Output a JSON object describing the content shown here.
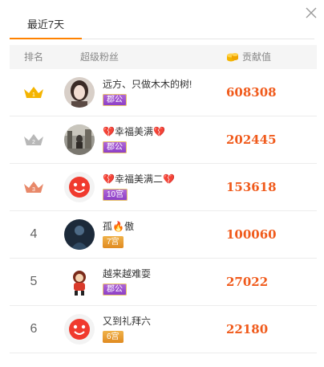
{
  "tabs": [
    {
      "label": "最近7天"
    }
  ],
  "table": {
    "headers": {
      "rank": "排名",
      "fan": "超级粉丝",
      "contribution": "贡献值"
    },
    "rows": [
      {
        "rank": "1",
        "rank_icon": "gold-crown-icon",
        "name": "远方、只做木木的树!",
        "badge": "郡公",
        "badge_style": "purple",
        "value": "608308",
        "avatar": "girl-photo"
      },
      {
        "rank": "2",
        "rank_icon": "silver-crown-icon",
        "name": "💔幸福美满💔",
        "badge": "郡公",
        "badge_style": "purple",
        "value": "202445",
        "avatar": "street-photo"
      },
      {
        "rank": "3",
        "rank_icon": "bronze-crown-icon",
        "name": "💔幸福美满二💔",
        "badge": "10宫",
        "badge_style": "purple",
        "value": "153618",
        "avatar": "red-smiley"
      },
      {
        "rank": "4",
        "name": "孤🔥傲",
        "badge": "7宫",
        "badge_style": "orange",
        "value": "100060",
        "avatar": "dark-photo"
      },
      {
        "rank": "5",
        "name": "越来越难耍",
        "badge": "郡公",
        "badge_style": "purple",
        "value": "27022",
        "avatar": "cartoon-figure"
      },
      {
        "rank": "6",
        "name": "又到礼拜六",
        "badge": "6宫",
        "badge_style": "orange",
        "value": "22180",
        "avatar": "red-smiley"
      }
    ]
  },
  "colors": {
    "accent": "#ff8200",
    "value": "#f05a1b",
    "gold": "#f4b400",
    "silver": "#b8b8b8",
    "bronze": "#e8896a"
  }
}
